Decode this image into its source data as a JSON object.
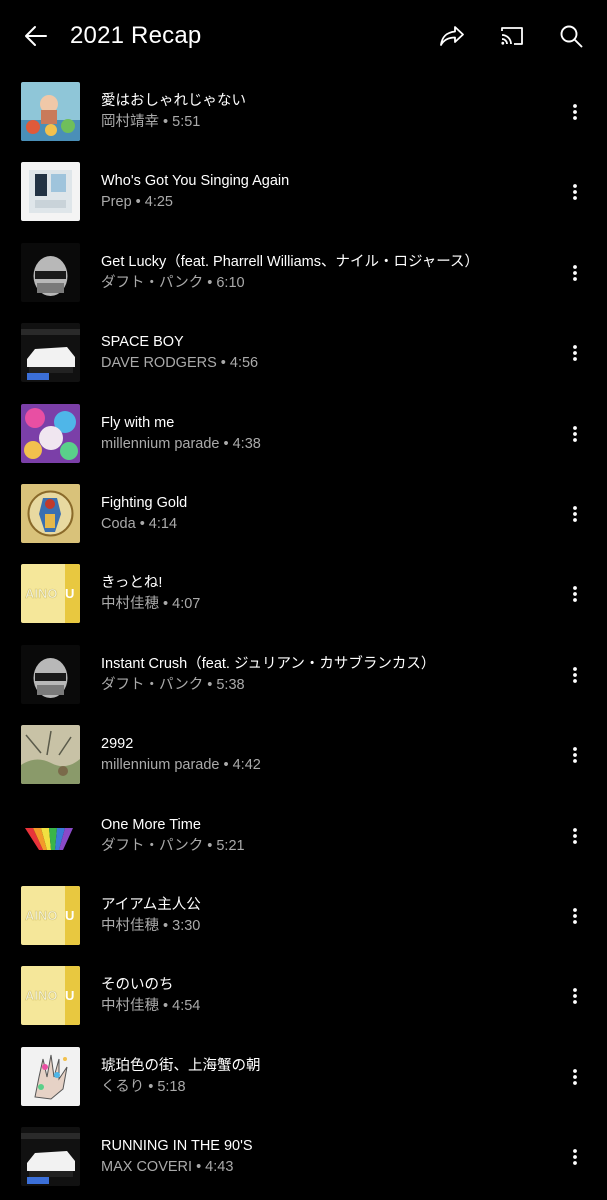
{
  "header": {
    "title": "2021 Recap",
    "icons": [
      "back-arrow-icon",
      "share-icon",
      "cast-icon",
      "search-icon"
    ]
  },
  "colors": {
    "background": "#000000",
    "primary_text": "#ffffff",
    "secondary_text": "#aaaaaa"
  },
  "tracks": [
    {
      "title": "愛はおしゃれじゃない",
      "subtitle": "岡村靖幸 • 5:51"
    },
    {
      "title": "Who's Got You Singing Again",
      "subtitle": "Prep • 4:25"
    },
    {
      "title": "Get Lucky（feat. Pharrell Williams、ナイル・ロジャース）",
      "subtitle": "ダフト・パンク • 6:10"
    },
    {
      "title": "SPACE BOY",
      "subtitle": "DAVE RODGERS • 4:56"
    },
    {
      "title": "Fly with me",
      "subtitle": "millennium parade • 4:38"
    },
    {
      "title": "Fighting Gold",
      "subtitle": "Coda • 4:14"
    },
    {
      "title": "きっとね!",
      "subtitle": "中村佳穂 • 4:07"
    },
    {
      "title": "Instant Crush（feat. ジュリアン・カサブランカス）",
      "subtitle": "ダフト・パンク • 5:38"
    },
    {
      "title": "2992",
      "subtitle": "millennium parade • 4:42"
    },
    {
      "title": "One More Time",
      "subtitle": "ダフト・パンク • 5:21"
    },
    {
      "title": "アイアム主人公",
      "subtitle": "中村佳穂 • 3:30"
    },
    {
      "title": "そのいのち",
      "subtitle": "中村佳穂 • 4:54"
    },
    {
      "title": "琥珀色の街、上海蟹の朝",
      "subtitle": "くるり • 5:18"
    },
    {
      "title": "RUNNING IN THE 90'S",
      "subtitle": "MAX COVERI • 4:43"
    }
  ]
}
